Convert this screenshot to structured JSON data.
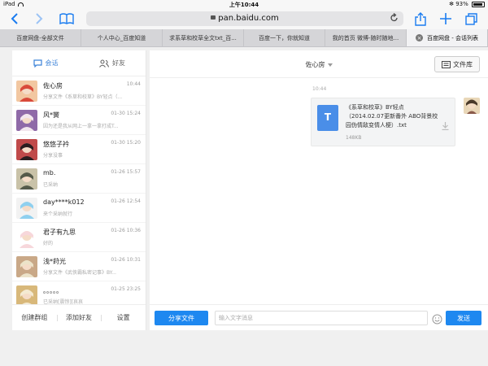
{
  "status_bar": {
    "device": "iPad",
    "time": "上午10:44",
    "battery": "93%",
    "battery_level": 0.93
  },
  "browser": {
    "url": "pan.baidu.com",
    "tabs": [
      {
        "label": "百度网盘-全部文件",
        "active": false
      },
      {
        "label": "个人中心_百度知道",
        "active": false
      },
      {
        "label": "求系草和校草全文txt_百...",
        "active": false
      },
      {
        "label": "百度一下，你就知道",
        "active": false
      },
      {
        "label": "我的首页 微博-随时随地...",
        "active": false
      },
      {
        "label": "百度网盘 - 会话列表",
        "active": true
      }
    ]
  },
  "sidebar": {
    "tab_chats": "会话",
    "tab_friends": "好友",
    "conversations": [
      {
        "name": "佐心房",
        "time": "10:44",
        "preview": "分享文件《系草和校草》BY轻点（...",
        "avatar_colors": [
          "#d94a3a",
          "#f2c7a1"
        ]
      },
      {
        "name": "风*黉",
        "time": "01-30 15:24",
        "preview": "因为还是我从网上一拿一拿打成T...",
        "avatar_colors": [
          "#f2e7ee",
          "#8f6aa8"
        ]
      },
      {
        "name": "悠悠子衿",
        "time": "01-30 15:20",
        "preview": "分享没事",
        "avatar_colors": [
          "#2b1d1f",
          "#c04a4a"
        ]
      },
      {
        "name": "mb.",
        "time": "01-26 15:57",
        "preview": "已采纳",
        "avatar_colors": [
          "#555a4a",
          "#c9c2a8"
        ]
      },
      {
        "name": "day****k012",
        "time": "01-26 12:54",
        "preview": "来个采纳就行",
        "avatar_colors": [
          "#8fd0ef",
          "#f2f2f2"
        ]
      },
      {
        "name": "君子有九思",
        "time": "01-26 10:36",
        "preview": "好的",
        "avatar_colors": [
          "#f7d7db",
          "#ffffff"
        ]
      },
      {
        "name": "浅*莳光",
        "time": "01-26 10:31",
        "preview": "分享文件《武侠霸私密记事》BY...",
        "avatar_colors": [
          "#ece3c9",
          "#c9a887"
        ]
      },
      {
        "name": "。。。。。",
        "time": "01-25 23:25",
        "preview": "已采纳[震惊][哀哀",
        "avatar_colors": [
          "#f4ead2",
          "#d8b87a"
        ]
      }
    ],
    "footer": {
      "create_group": "创建群组",
      "add_friend": "添加好友",
      "settings": "设置"
    }
  },
  "chat": {
    "contact_name": "佐心房",
    "library_button": "文件库",
    "message_time": "10:44",
    "file": {
      "icon_letter": "T",
      "name": "《系草和校草》BY轻点（2014.02.07更新番外 ABO背景校园伪情敌变情人梗）.txt",
      "size": "148KB"
    },
    "input": {
      "share_button": "分享文件",
      "placeholder": "输入文字消息",
      "send_button": "发送"
    }
  },
  "colors": {
    "accent": "#1e88f0",
    "ios_blue": "#1a7cf0"
  }
}
